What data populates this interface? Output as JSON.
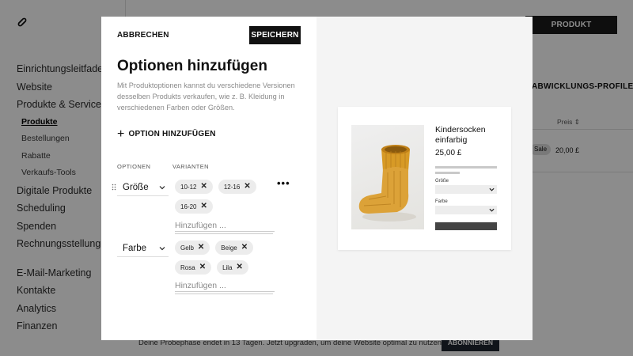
{
  "background": {
    "navigation": {
      "items": [
        {
          "label": "Einrichtungsleitfaden"
        },
        {
          "label": "Website"
        },
        {
          "label": "Produkte & Services"
        }
      ],
      "sub_items": [
        {
          "label": "Produkte",
          "active": true
        },
        {
          "label": "Bestellungen"
        },
        {
          "label": "Rabatte"
        },
        {
          "label": "Verkaufs-Tools"
        }
      ],
      "items_after": [
        {
          "label": "Digitale Produkte"
        },
        {
          "label": "Scheduling"
        },
        {
          "label": "Spenden"
        },
        {
          "label": "Rechnungsstellung"
        }
      ],
      "items_bottom": [
        {
          "label": "E-Mail-Marketing"
        },
        {
          "label": "Kontakte"
        },
        {
          "label": "Analytics"
        },
        {
          "label": "Finanzen"
        }
      ]
    },
    "add_product_label": "PRODUKT HINZUFÜGEN",
    "tab_label": "ABWICKLUNGS-PROFILE",
    "price_column": "Preis ⇕",
    "row_badge": "Sale",
    "row_price": "20,00 £",
    "trial_text": "Deine Probephase endet in 13 Tagen. Jetzt upgraden, um deine Website optimal zu nutzen.",
    "trial_button": "ABONNIEREN"
  },
  "modal": {
    "cancel_label": "ABBRECHEN",
    "save_label": "SPEICHERN",
    "title": "Optionen hinzufügen",
    "description": "Mit Produktoptionen kannst du verschiedene Versionen desselben Produkts verkaufen, wie z. B. Kleidung in verschiedenen Farben oder Größen.",
    "add_option_label": "OPTION HINZUFÜGEN",
    "options_header": "OPTIONEN",
    "variants_header": "VARIANTEN",
    "more_label": "•••",
    "options": [
      {
        "name": "Größe",
        "variants": [
          "10-12",
          "12-16",
          "16-20"
        ],
        "input_placeholder": "Hinzufügen ..."
      },
      {
        "name": "Farbe",
        "variants": [
          "Gelb",
          "Beige",
          "Rosa",
          "Lila"
        ],
        "input_placeholder": "Hinzufügen ..."
      }
    ]
  },
  "preview": {
    "product_name": "Kindersocken einfarbig",
    "price": "25,00 £",
    "select_labels": [
      "Größe",
      "Farbe"
    ],
    "image_icon": "yellow-knit-baby-sock"
  },
  "colors": {
    "accent": "#111111",
    "chip_bg": "#ececec",
    "preview_bg": "#f4f4f4",
    "sock": "#d69a2a",
    "overlay": "rgba(0,0,0,0.45)"
  }
}
